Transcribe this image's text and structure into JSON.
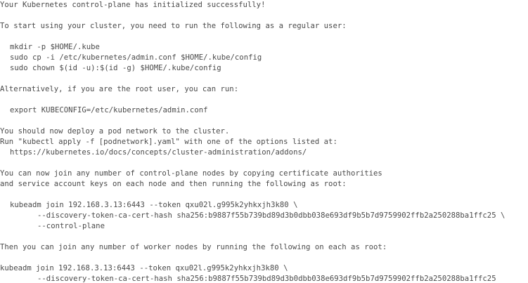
{
  "terminal": {
    "success_message": "Your Kubernetes control-plane has initialized successfully!",
    "regular_user_intro": "To start using your cluster, you need to run the following as a regular user:",
    "regular_user_commands": [
      "mkdir -p $HOME/.kube",
      "sudo cp -i /etc/kubernetes/admin.conf $HOME/.kube/config",
      "sudo chown $(id -u):$(id -g) $HOME/.kube/config"
    ],
    "root_user_intro": "Alternatively, if you are the root user, you can run:",
    "root_user_command": "export KUBECONFIG=/etc/kubernetes/admin.conf",
    "pod_network_line_1": "You should now deploy a pod network to the cluster.",
    "pod_network_line_2": "Run \"kubectl apply -f [podnetwork].yaml\" with one of the options listed at:",
    "pod_network_url": "https://kubernetes.io/docs/concepts/cluster-administration/addons/",
    "control_plane_join_line_1": "You can now join any number of control-plane nodes by copying certificate authorities",
    "control_plane_join_line_2": "and service account keys on each node and then running the following as root:",
    "control_plane_join_command": [
      "kubeadm join 192.168.3.13:6443 --token qxu02l.g995k2yhkxjh3k80 \\",
      "--discovery-token-ca-cert-hash sha256:b9887f55b739bd89d3b0dbb038e693df9b5b7d9759902ffb2a250288ba1ffc25 \\",
      "--control-plane"
    ],
    "worker_join_intro": "Then you can join any number of worker nodes by running the following on each as root:",
    "worker_join_command": [
      "kubeadm join 192.168.3.13:6443 --token qxu02l.g995k2yhkxjh3k80 \\",
      "--discovery-token-ca-cert-hash sha256:b9887f55b739bd89d3b0dbb038e693df9b5b7d9759902ffb2a250288ba1ffc25"
    ]
  }
}
